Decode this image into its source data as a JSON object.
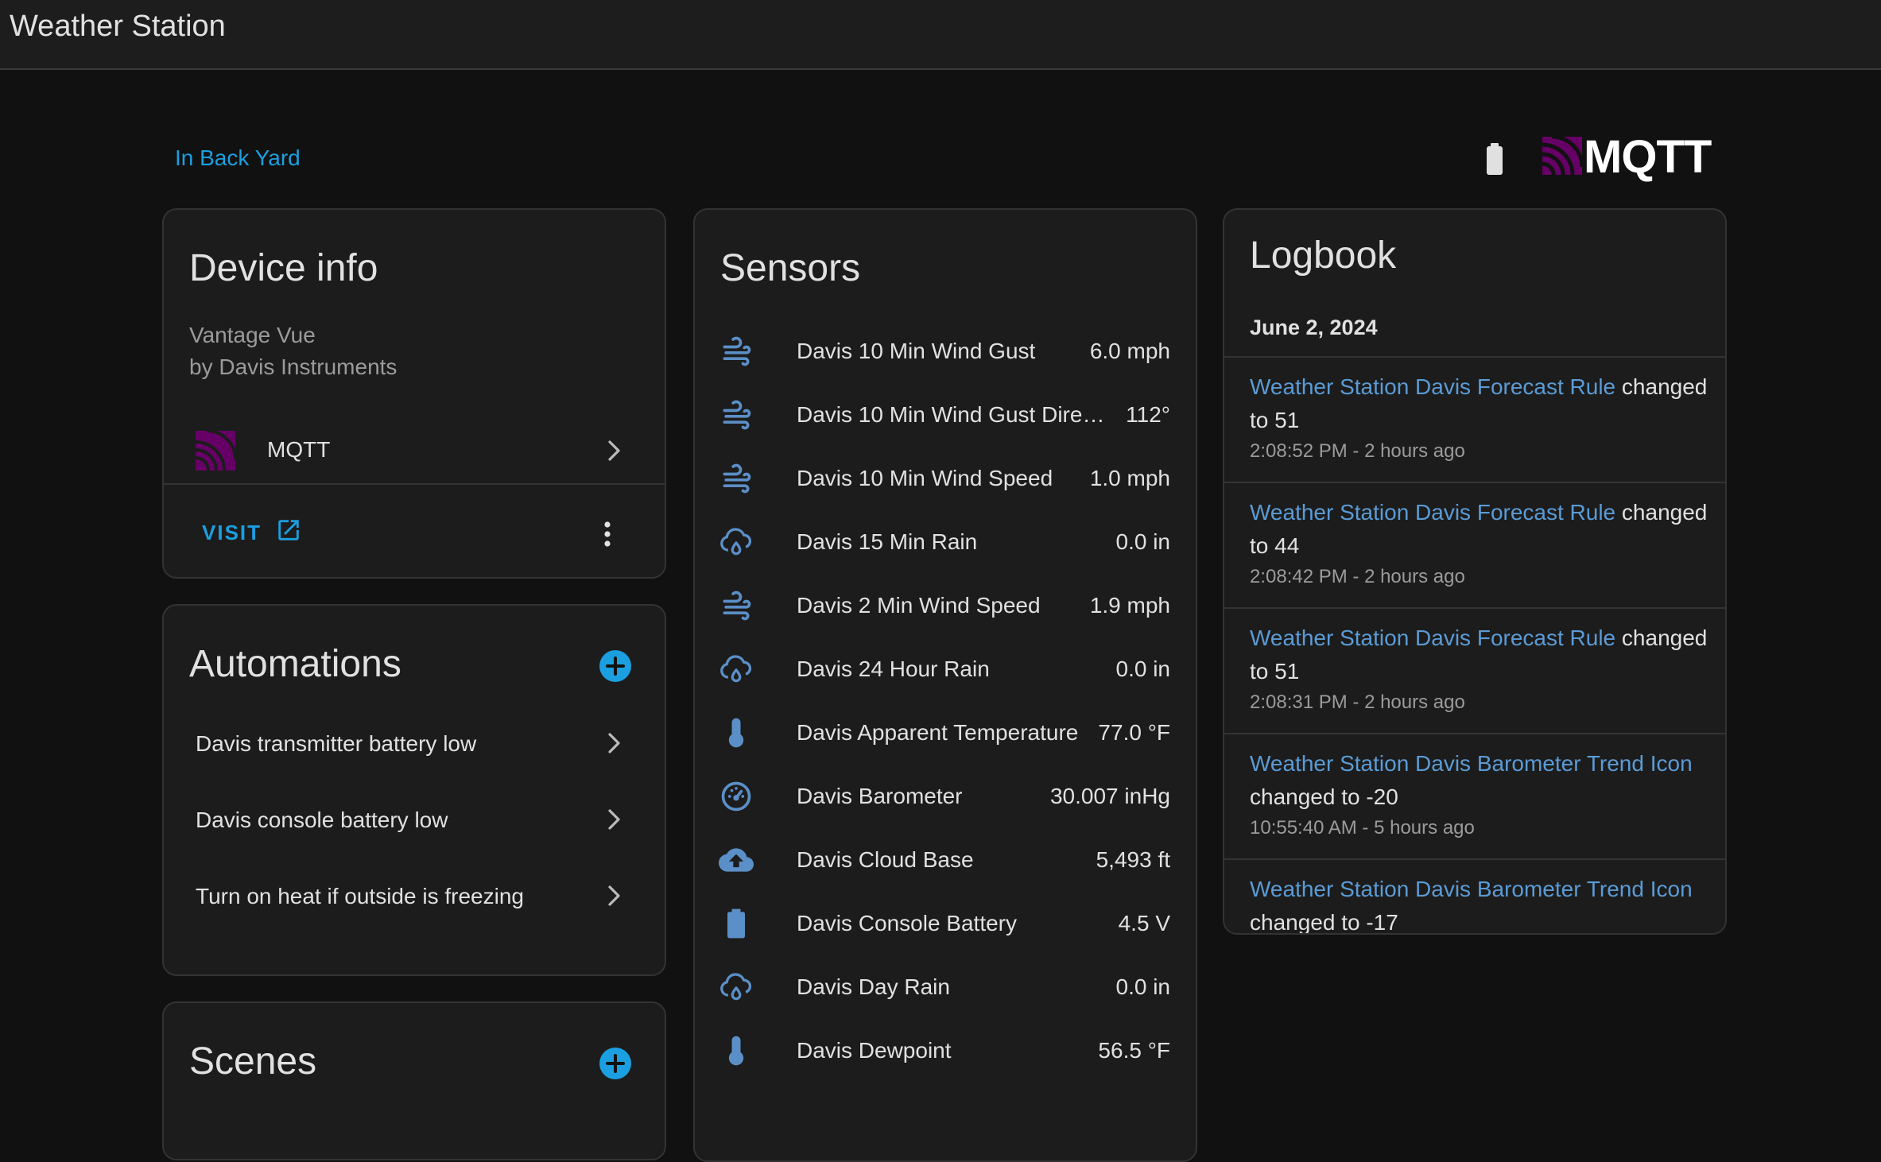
{
  "header": {
    "title": "Weather Station"
  },
  "area": {
    "label": "In Back Yard"
  },
  "logo": {
    "text": "MQTT",
    "color": "#660066"
  },
  "device_info": {
    "title": "Device info",
    "model": "Vantage Vue",
    "manufacturer": "by Davis Instruments",
    "integration": {
      "label": "MQTT",
      "icon": "mqtt-icon"
    },
    "visit_label": "VISIT"
  },
  "automations": {
    "title": "Automations",
    "items": [
      {
        "label": "Davis transmitter battery low"
      },
      {
        "label": "Davis console battery low"
      },
      {
        "label": "Turn on heat if outside is freezing"
      }
    ]
  },
  "scenes": {
    "title": "Scenes"
  },
  "sensors": {
    "title": "Sensors",
    "items": [
      {
        "icon": "wind-icon",
        "name": "Davis 10 Min Wind Gust",
        "value": "6.0 mph"
      },
      {
        "icon": "wind-icon",
        "name": "Davis 10 Min Wind Gust Direc...",
        "value": "112°"
      },
      {
        "icon": "wind-icon",
        "name": "Davis 10 Min Wind Speed",
        "value": "1.0 mph"
      },
      {
        "icon": "rain-icon",
        "name": "Davis 15 Min Rain",
        "value": "0.0 in"
      },
      {
        "icon": "wind-icon",
        "name": "Davis 2 Min Wind Speed",
        "value": "1.9 mph"
      },
      {
        "icon": "rain-icon",
        "name": "Davis 24 Hour Rain",
        "value": "0.0 in"
      },
      {
        "icon": "thermometer-icon",
        "name": "Davis Apparent Temperature",
        "value": "77.0 °F"
      },
      {
        "icon": "gauge-icon",
        "name": "Davis Barometer",
        "value": "30.007 inHg"
      },
      {
        "icon": "cloud-upload-icon",
        "name": "Davis Cloud Base",
        "value": "5,493 ft"
      },
      {
        "icon": "battery-icon",
        "name": "Davis Console Battery",
        "value": "4.5 V"
      },
      {
        "icon": "rain-icon",
        "name": "Davis Day Rain",
        "value": "0.0 in"
      },
      {
        "icon": "thermometer-icon",
        "name": "Davis Dewpoint",
        "value": "56.5 °F"
      }
    ]
  },
  "logbook": {
    "title": "Logbook",
    "date": "June 2, 2024",
    "entries": [
      {
        "entity": "Weather Station Davis Forecast Rule",
        "message": " changed to 51",
        "time": "2:08:52 PM - 2 hours ago"
      },
      {
        "entity": "Weather Station Davis Forecast Rule",
        "message": " changed to 44",
        "time": "2:08:42 PM - 2 hours ago"
      },
      {
        "entity": "Weather Station Davis Forecast Rule",
        "message": " changed to 51",
        "time": "2:08:31 PM - 2 hours ago"
      },
      {
        "entity": "Weather Station Davis Barometer Trend Icon",
        "message": " changed to -20",
        "time": "10:55:40 AM - 5 hours ago"
      },
      {
        "entity": "Weather Station Davis Barometer Trend Icon",
        "message": " changed to -17",
        "time": ""
      }
    ]
  },
  "colors": {
    "accent": "#1b9fe0",
    "sensor_icon": "#5b8fc7",
    "log_link": "#5b9bd5",
    "mqtt_purple": "#660066"
  }
}
